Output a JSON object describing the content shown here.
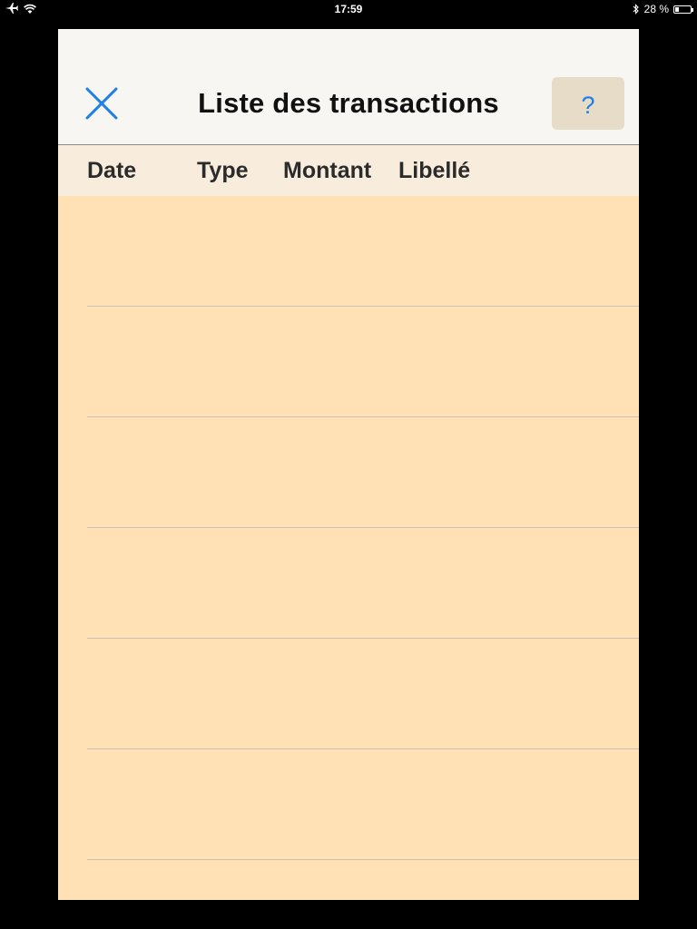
{
  "status_bar": {
    "time": "17:59",
    "battery_text": "28 %",
    "battery_level": 0.28,
    "icons": [
      "airplane-icon",
      "wifi-icon",
      "bluetooth-icon",
      "battery-icon"
    ]
  },
  "nav": {
    "title": "Liste des transactions",
    "close_icon": "close-icon",
    "help_label": "?"
  },
  "columns": [
    "Date",
    "Type",
    "Montant",
    "Libellé"
  ],
  "rows": [
    {
      "date": "",
      "type": "",
      "amount": "",
      "label": ""
    },
    {
      "date": "",
      "type": "",
      "amount": "",
      "label": ""
    },
    {
      "date": "",
      "type": "",
      "amount": "",
      "label": ""
    },
    {
      "date": "",
      "type": "",
      "amount": "",
      "label": ""
    },
    {
      "date": "",
      "type": "",
      "amount": "",
      "label": ""
    },
    {
      "date": "",
      "type": "",
      "amount": "",
      "label": ""
    }
  ],
  "colors": {
    "accent": "#1e7fe6",
    "list_background": "#ffe1b5",
    "header_background": "#f8eddc"
  }
}
